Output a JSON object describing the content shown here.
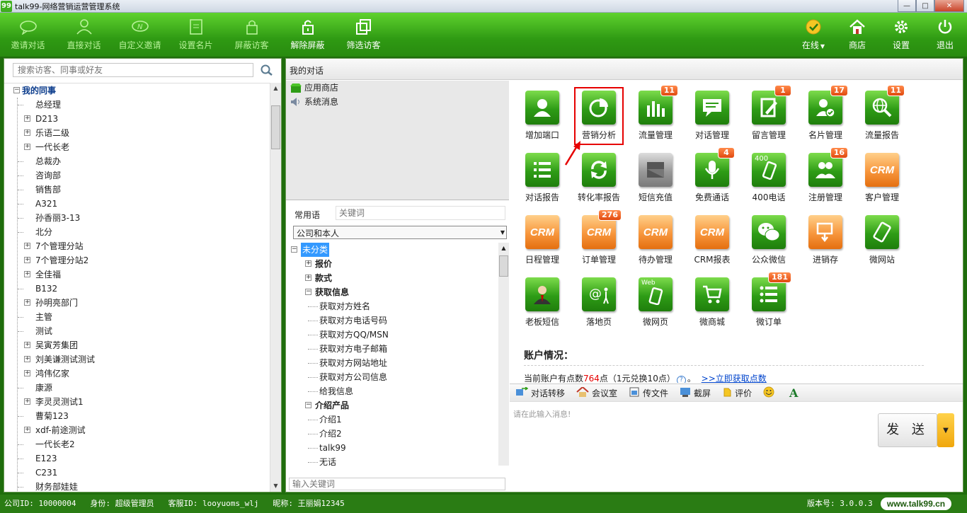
{
  "window": {
    "title": "talk99-网络营销运营管理系统",
    "logo_text": "99",
    "min": "—",
    "max": "□",
    "close": "✕"
  },
  "toolbar": {
    "left": [
      {
        "label": "邀请对话",
        "icon": "chat-bubble-icon",
        "enabled": false
      },
      {
        "label": "直接对话",
        "icon": "person-icon",
        "enabled": false
      },
      {
        "label": "自定义邀请",
        "icon": "custom-invite-icon",
        "enabled": false
      },
      {
        "label": "设置名片",
        "icon": "card-icon",
        "enabled": false
      },
      {
        "label": "屏蔽访客",
        "icon": "lock-icon",
        "enabled": false
      },
      {
        "label": "解除屏蔽",
        "icon": "unlock-icon",
        "enabled": true
      },
      {
        "label": "筛选访客",
        "icon": "filter-icon",
        "enabled": true
      }
    ],
    "right": [
      {
        "label": "在线",
        "icon": "online-check-icon",
        "dropdown": "▼"
      },
      {
        "label": "商店",
        "icon": "home-icon"
      },
      {
        "label": "设置",
        "icon": "gear-icon"
      },
      {
        "label": "退出",
        "icon": "power-icon"
      }
    ]
  },
  "left_panel": {
    "search_placeholder": "搜索访客、同事或好友",
    "tree_root": "我的同事",
    "tree_items": [
      {
        "label": "总经理",
        "expandable": false
      },
      {
        "label": "D213",
        "expandable": true
      },
      {
        "label": "乐语二级",
        "expandable": true
      },
      {
        "label": "一代长老",
        "expandable": true
      },
      {
        "label": "总裁办",
        "expandable": false
      },
      {
        "label": "咨询部",
        "expandable": false
      },
      {
        "label": "销售部",
        "expandable": false
      },
      {
        "label": "A321",
        "expandable": false
      },
      {
        "label": "孙香丽3-13",
        "expandable": false
      },
      {
        "label": "北分",
        "expandable": false
      },
      {
        "label": "7个管理分站",
        "expandable": true
      },
      {
        "label": "7个管理分站2",
        "expandable": true
      },
      {
        "label": "全佳福",
        "expandable": true
      },
      {
        "label": "B132",
        "expandable": false
      },
      {
        "label": "孙明亮部门",
        "expandable": true
      },
      {
        "label": "主管",
        "expandable": false
      },
      {
        "label": "测试",
        "expandable": false
      },
      {
        "label": "吴寅芳集团",
        "expandable": true
      },
      {
        "label": "刘美谦测试测试",
        "expandable": true
      },
      {
        "label": "鸿伟亿家",
        "expandable": true
      },
      {
        "label": "康源",
        "expandable": false
      },
      {
        "label": "李灵灵测试1",
        "expandable": true
      },
      {
        "label": "曹菊123",
        "expandable": false
      },
      {
        "label": "xdf-前途测试",
        "expandable": true
      },
      {
        "label": "一代长老2",
        "expandable": false
      },
      {
        "label": "E123",
        "expandable": false
      },
      {
        "label": "C231",
        "expandable": false
      },
      {
        "label": "财务部娃娃",
        "expandable": false
      }
    ]
  },
  "chat": {
    "header": "我的对话",
    "conversations": [
      {
        "label": "应用商店",
        "icon": "store-icon"
      },
      {
        "label": "系统消息",
        "icon": "speaker-icon"
      }
    ]
  },
  "phrases": {
    "tab_label": "常用语",
    "keyword_placeholder": "关键词",
    "scope_select": "公司和本人",
    "tree": [
      {
        "label": "未分类",
        "level": 0,
        "exp": "⊟",
        "selected": true
      },
      {
        "label": "报价",
        "level": 1,
        "exp": "⊞",
        "bold": true
      },
      {
        "label": "款式",
        "level": 1,
        "exp": "⊞",
        "bold": true
      },
      {
        "label": "获取信息",
        "level": 1,
        "exp": "⊟",
        "bold": true
      },
      {
        "label": "获取对方姓名",
        "level": 2
      },
      {
        "label": "获取对方电话号码",
        "level": 2
      },
      {
        "label": "获取对方QQ/MSN",
        "level": 2
      },
      {
        "label": "获取对方电子邮箱",
        "level": 2
      },
      {
        "label": "获取对方网站地址",
        "level": 2
      },
      {
        "label": "获取对方公司信息",
        "level": 2
      },
      {
        "label": "给我信息",
        "level": 2
      },
      {
        "label": "介绍产品",
        "level": 1,
        "exp": "⊟",
        "bold": true
      },
      {
        "label": "介绍1",
        "level": 2
      },
      {
        "label": "介绍2",
        "level": 2
      },
      {
        "label": "talk99",
        "level": 2
      },
      {
        "label": "无话",
        "level": 2
      }
    ],
    "bottom_placeholder": "输入关键词"
  },
  "apps": [
    {
      "label": "增加端口",
      "icon": "add-port-icon",
      "style": "g",
      "badge": ""
    },
    {
      "label": "营销分析",
      "icon": "pie-chart-icon",
      "style": "g",
      "badge": "",
      "highlight": true
    },
    {
      "label": "流量管理",
      "icon": "bar-chart-icon",
      "style": "g",
      "badge": "11"
    },
    {
      "label": "对话管理",
      "icon": "dialog-icon",
      "style": "g",
      "badge": ""
    },
    {
      "label": "留言管理",
      "icon": "note-icon",
      "style": "g",
      "badge": "1"
    },
    {
      "label": "名片管理",
      "icon": "card-check-icon",
      "style": "g",
      "badge": "17"
    },
    {
      "label": "流量报告",
      "icon": "globe-search-icon",
      "style": "g",
      "badge": "11"
    },
    {
      "label": "对话报告",
      "icon": "list-icon",
      "style": "g",
      "badge": ""
    },
    {
      "label": "转化率报告",
      "icon": "refresh-icon",
      "style": "g",
      "badge": ""
    },
    {
      "label": "短信充值",
      "icon": "sms-icon",
      "style": "gy",
      "badge": ""
    },
    {
      "label": "免费通话",
      "icon": "mic-icon",
      "style": "g",
      "badge": "4"
    },
    {
      "label": "400电话",
      "icon": "phone-icon",
      "style": "g",
      "badge": ""
    },
    {
      "label": "注册管理",
      "icon": "users-icon",
      "style": "g",
      "badge": "16"
    },
    {
      "label": "客户管理",
      "icon": "crm-icon",
      "style": "o",
      "badge": "",
      "crm": "CRM"
    },
    {
      "label": "日程管理",
      "icon": "crm-icon",
      "style": "o",
      "badge": "",
      "crm": "CRM"
    },
    {
      "label": "订单管理",
      "icon": "crm-icon",
      "style": "o",
      "badge": "276",
      "crm": "CRM"
    },
    {
      "label": "待办管理",
      "icon": "crm-icon",
      "style": "o",
      "badge": "",
      "crm": "CRM"
    },
    {
      "label": "CRM报表",
      "icon": "crm-icon",
      "style": "o",
      "badge": "",
      "crm": "CRM"
    },
    {
      "label": "公众微信",
      "icon": "wechat-icon",
      "style": "g",
      "badge": ""
    },
    {
      "label": "进销存",
      "icon": "inventory-icon",
      "style": "o",
      "badge": ""
    },
    {
      "label": "微网站",
      "icon": "mobile-site-icon",
      "style": "g",
      "badge": ""
    },
    {
      "label": "老板短信",
      "icon": "boss-icon",
      "style": "g",
      "badge": ""
    },
    {
      "label": "落地页",
      "icon": "landing-page-icon",
      "style": "g",
      "badge": ""
    },
    {
      "label": "微网页",
      "icon": "web-mobile-icon",
      "style": "g",
      "badge": ""
    },
    {
      "label": "微商城",
      "icon": "cart-icon",
      "style": "g",
      "badge": ""
    },
    {
      "label": "微订单",
      "icon": "order-list-icon",
      "style": "g",
      "badge": "181"
    }
  ],
  "icon_text": {
    "phone": "400",
    "web": "Web"
  },
  "account": {
    "title": "账户情况：",
    "prefix": "当前账户有点数",
    "points": "764",
    "suffix": "点（1元兑换10点）",
    "help": "?",
    "dot": "。",
    "link": ">>立即获取点数"
  },
  "msg_tools": [
    {
      "label": "对话转移",
      "icon": "transfer-icon"
    },
    {
      "label": "会议室",
      "icon": "meeting-icon"
    },
    {
      "label": "传文件",
      "icon": "file-icon"
    },
    {
      "label": "截屏",
      "icon": "screenshot-icon"
    },
    {
      "label": "评价",
      "icon": "rate-icon"
    },
    {
      "label": "",
      "icon": "emoji-icon"
    },
    {
      "label": "",
      "icon": "font-icon"
    }
  ],
  "message": {
    "placeholder": "请在此输入消息!",
    "send": "发 送",
    "dropdown": "▼"
  },
  "status": {
    "company": "公司ID: 10000004",
    "role": "身份: 超级管理员",
    "agent": "客服ID: looyuoms_wlj",
    "nickname": "昵称: 王丽娟12345",
    "version": "版本号: 3.0.0.3",
    "site": "www.talk99.cn"
  }
}
